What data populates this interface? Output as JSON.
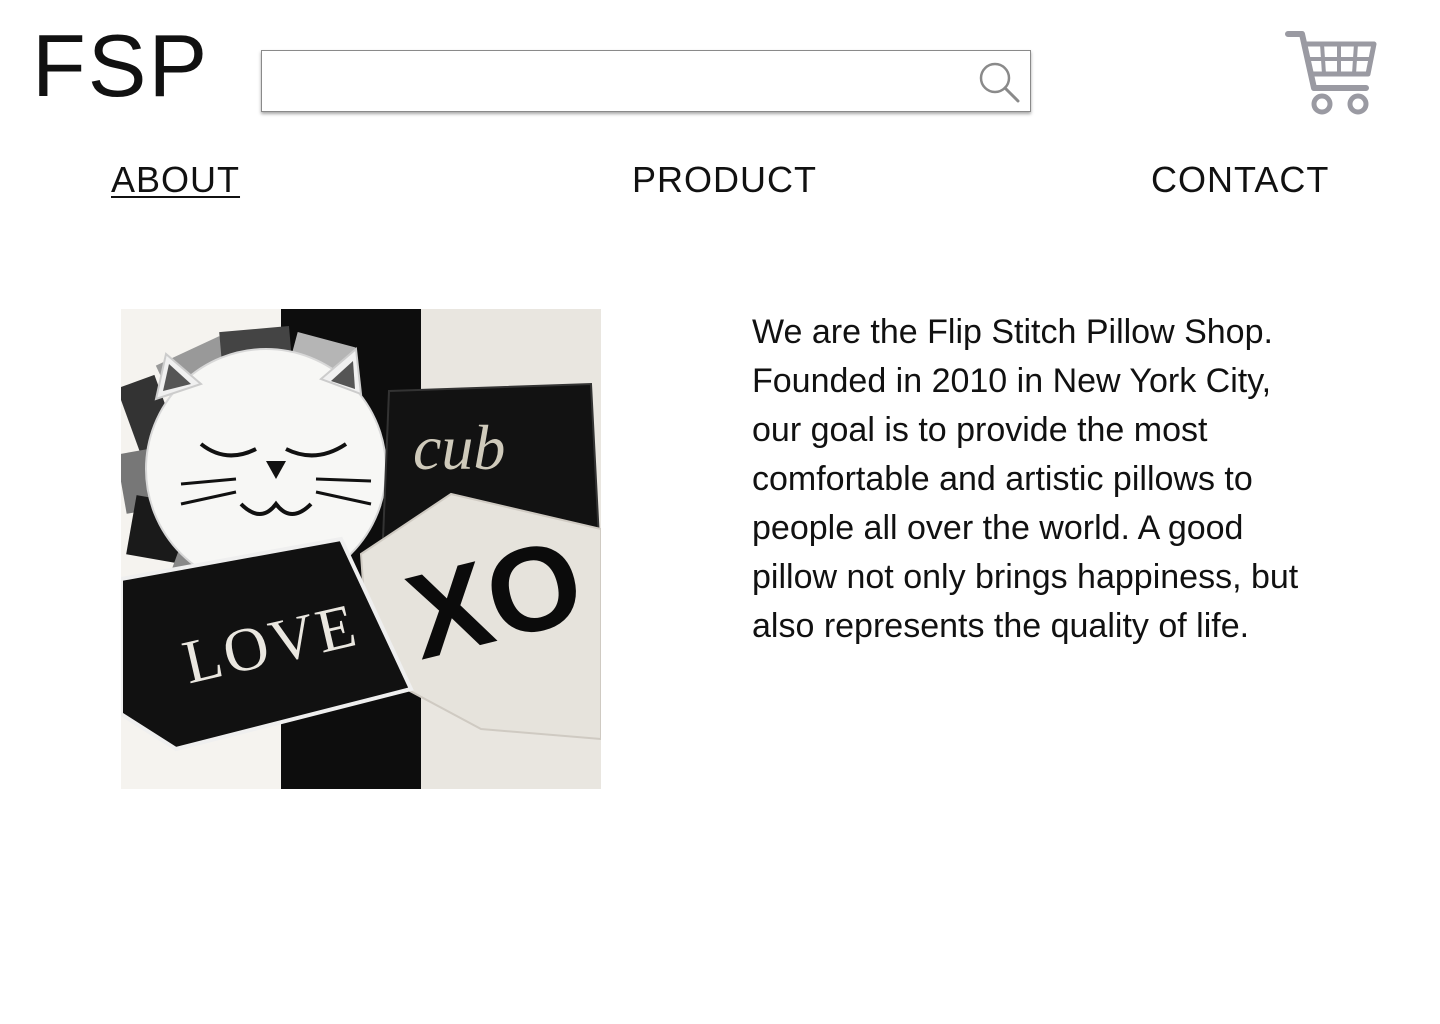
{
  "brand": {
    "logo_text": "FSP"
  },
  "search": {
    "value": "",
    "placeholder": ""
  },
  "nav": {
    "about": "ABOUT",
    "product": "PRODUCT",
    "contact": "CONTACT",
    "active": "about"
  },
  "hero": {
    "image_icon": "pillow-product-photo",
    "pillow_texts": [
      "cub",
      "LOVE",
      "XO"
    ]
  },
  "about": {
    "body": "We are the Flip Stitch Pillow Shop. Founded in 2010 in New York City, our goal is to provide the most comfortable and artistic pillows to people all over the world. A good pillow not only brings happiness, but also represents the quality of life."
  },
  "icons": {
    "search": "search-icon",
    "cart": "shopping-cart-icon"
  },
  "colors": {
    "text": "#111111",
    "icon_gray": "#9a9aa2",
    "accent_black": "#111111"
  }
}
